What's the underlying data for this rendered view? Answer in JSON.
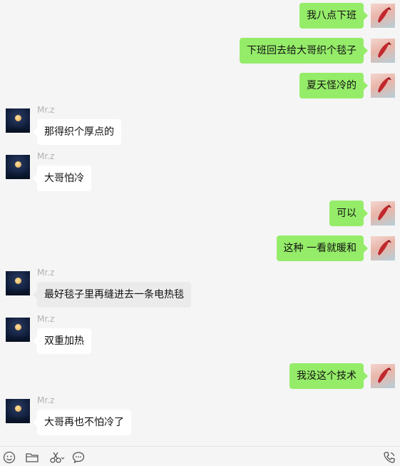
{
  "messages": [
    {
      "side": "self",
      "text": "我八点下班"
    },
    {
      "side": "self",
      "text": "下班回去给大哥织个毯子"
    },
    {
      "side": "self",
      "text": "夏天怪冷的"
    },
    {
      "side": "other",
      "name": "Mr.z",
      "text": "那得织个厚点的"
    },
    {
      "side": "other",
      "name": "Mr.z",
      "text": "大哥怕冷"
    },
    {
      "side": "self",
      "text": "可以"
    },
    {
      "side": "self",
      "text": "这种 一看就暖和"
    },
    {
      "side": "other",
      "name": "Mr.z",
      "text": "最好毯子里再缝进去一条电热毯"
    },
    {
      "side": "other",
      "name": "Mr.z",
      "text": "双重加热"
    },
    {
      "side": "self",
      "text": "我没这个技术"
    },
    {
      "side": "other",
      "name": "Mr.z",
      "text": "大哥再也不怕冷了"
    }
  ],
  "toolbar": {
    "left_icons": [
      "emoji-icon",
      "folder-icon",
      "scissors-icon",
      "chat-bubble-icon"
    ],
    "right_icons": [
      "phone-call-icon"
    ]
  },
  "colors": {
    "self_bubble": "#95ec69",
    "other_bubble": "#ffffff",
    "background": "#f5f5f5"
  }
}
